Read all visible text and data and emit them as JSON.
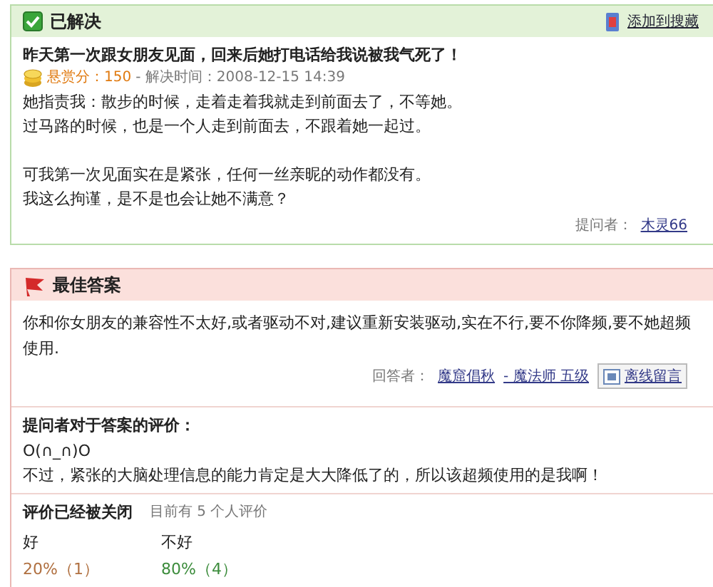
{
  "status": {
    "label": "已解决",
    "checked": true
  },
  "bookmark_link": "添加到搜藏",
  "question": {
    "title": "昨天第一次跟女朋友见面，回来后她打电话给我说被我气死了！",
    "reward": "悬赏分：150",
    "resolved": "- 解决时间：2008-12-15 14:39",
    "paragraphs": [
      [
        "她指责我：散步的时候，走着走着我就走到前面去了，不等她。",
        "过马路的时候，也是一个人走到前面去，不跟着她一起过。"
      ],
      [
        "可我第一次见面实在是紧张，任何一丝亲昵的动作都没有。",
        "我这么拘谨，是不是也会让她不满意？"
      ]
    ],
    "asker_label": "提问者：",
    "asker": "木灵66"
  },
  "best_answer": {
    "heading": "最佳答案",
    "text": "你和你女朋友的兼容性不太好,或者驱动不对,建议重新安装驱动,实在不行,要不你降频,要不她超频使用.",
    "answerer_label": "回答者：",
    "answerer": "魔窟倡秋",
    "rank": "- 魔法师 五级",
    "message_button": "离线留言"
  },
  "evaluation": {
    "heading": "提问者对于答案的评价：",
    "lines": [
      "O(∩_∩)O",
      "不过，紧张的大脑处理信息的能力肯定是大大降低了的，所以该超频使用的是我啊！"
    ]
  },
  "rating": {
    "closed": "评价已经被关闭",
    "count": "目前有 5 个人评价",
    "options": [
      {
        "label": "好",
        "result": "20%（1）",
        "color": "#b07040"
      },
      {
        "label": "不好",
        "result": "80%（4）",
        "color": "#3c8c3c"
      }
    ]
  }
}
